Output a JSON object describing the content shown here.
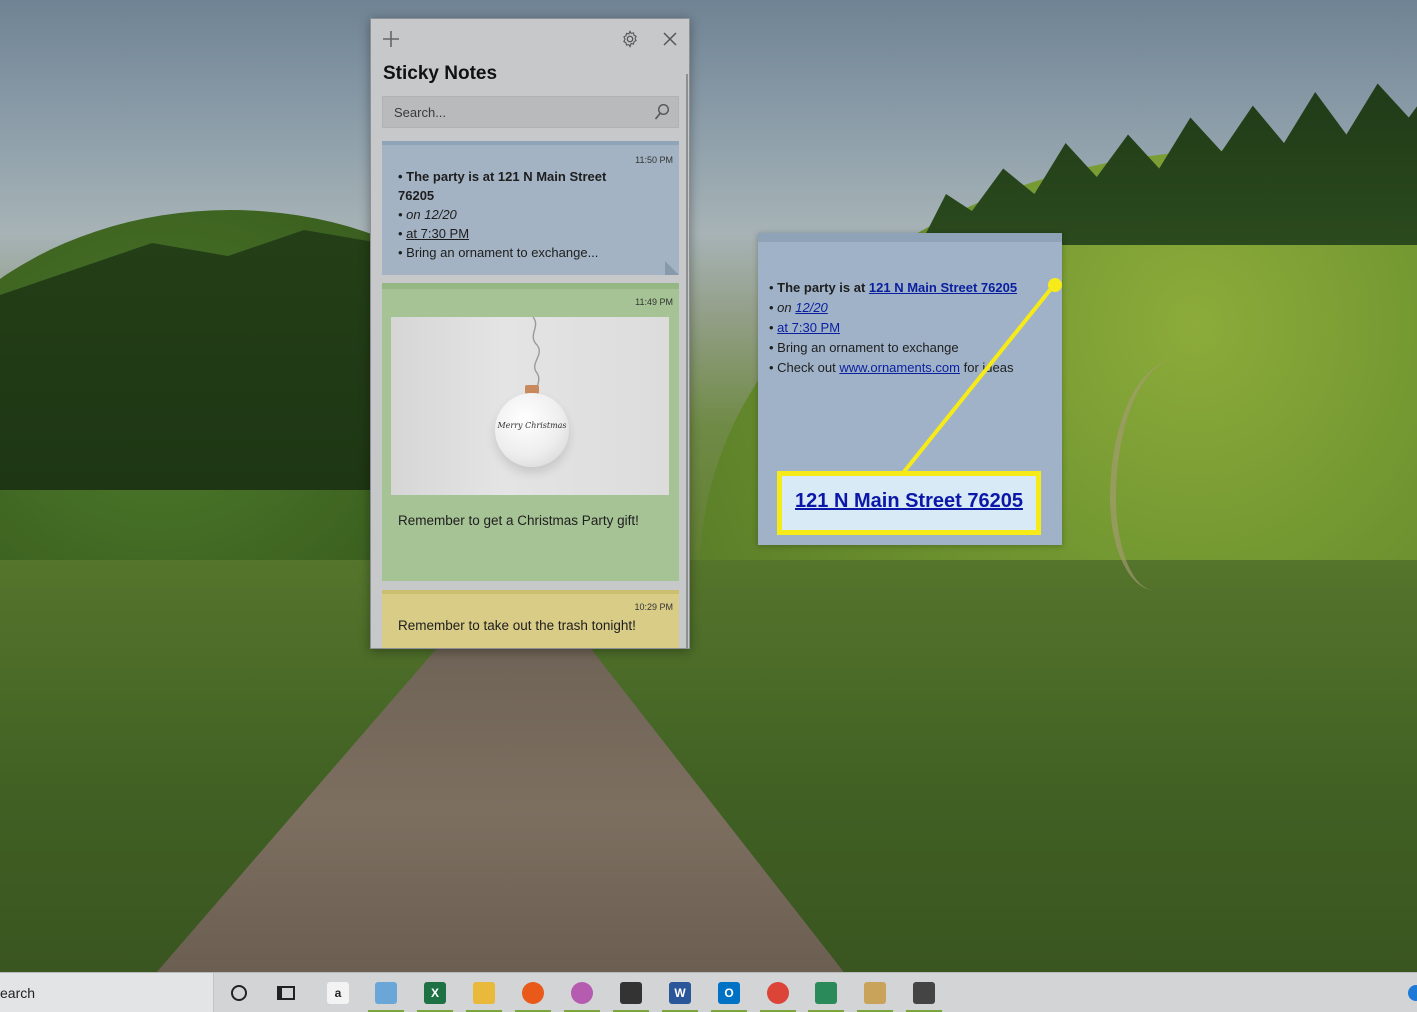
{
  "window": {
    "title": "Sticky Notes",
    "search_placeholder": "Search..."
  },
  "notes": [
    {
      "time": "11:50 PM",
      "color": "#a3b3c3",
      "lines": [
        "The party is at 121 N Main Street 76205",
        "on 12/20",
        "at 7:30 PM",
        "Bring an ornament to exchange..."
      ]
    },
    {
      "time": "11:49 PM",
      "color": "#a6c395",
      "image_caption": "Merry Christmas",
      "text": "Remember to get a Christmas Party gift!"
    },
    {
      "time": "10:29 PM",
      "color": "#d8cc87",
      "text": "Remember to take out the trash tonight!"
    }
  ],
  "expanded_note": {
    "line1_prefix": "The party is at ",
    "line1_link": "121 N Main Street 76205",
    "line2_prefix": "on ",
    "line2_link": "12/20",
    "line3_link": "at 7:30 PM",
    "line4": "Bring an ornament to exchange",
    "line5_prefix": "Check out ",
    "line5_link": "www.ornaments.com",
    "line5_suffix": " for ideas"
  },
  "callout": {
    "text": "121 N Main Street 76205",
    "color": "#f7ea19"
  },
  "taskbar": {
    "search_text": "earch",
    "apps": [
      {
        "name": "amazon",
        "label": "a",
        "color": "#f3f3f3"
      },
      {
        "name": "notepad-app",
        "label": "",
        "color": "#6aa7d8"
      },
      {
        "name": "excel",
        "label": "X",
        "color": "#1e7145"
      },
      {
        "name": "file-explorer",
        "label": "",
        "color": "#e8b93a"
      },
      {
        "name": "firefox",
        "label": "",
        "color": "#e8591a"
      },
      {
        "name": "snipping-tool",
        "label": "",
        "color": "#b55bb0"
      },
      {
        "name": "photos",
        "label": "",
        "color": "#333333"
      },
      {
        "name": "word",
        "label": "W",
        "color": "#2b579a"
      },
      {
        "name": "outlook",
        "label": "O",
        "color": "#0072c6"
      },
      {
        "name": "chrome",
        "label": "",
        "color": "#db4437"
      },
      {
        "name": "defender",
        "label": "",
        "color": "#2a8a5a"
      },
      {
        "name": "paint",
        "label": "",
        "color": "#c9a35a"
      },
      {
        "name": "sticky-notes",
        "label": "",
        "color": "#444444"
      }
    ]
  }
}
